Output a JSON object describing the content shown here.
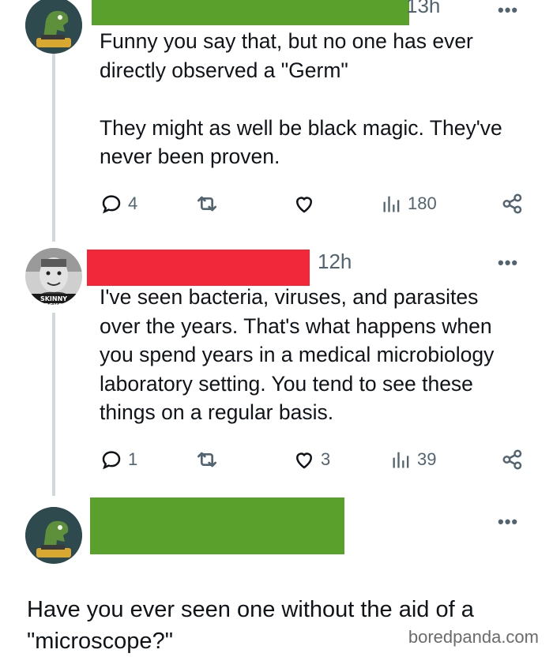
{
  "colors": {
    "redact_green": "#5aa02c",
    "redact_red": "#f0283a",
    "icon_gray": "#536471",
    "thread_line": "#cfd9de"
  },
  "tweets": [
    {
      "avatar": "dinosaur-avatar",
      "redaction_color": "green",
      "time": "13h",
      "text": "Funny you say that, but no one has ever\ndirectly observed a \"Germ\"\n\nThey might as well be black magic. They've\nnever been proven.",
      "actions": {
        "replies": "4",
        "retweets": "",
        "likes": "",
        "views": "180"
      }
    },
    {
      "avatar": "man-portrait-avatar",
      "avatar_caption": "SKINNY RECKON",
      "redaction_color": "red",
      "time": "12h",
      "text": "I've seen bacteria, viruses, and parasites\nover the years. That's what happens when\nyou spend years in a medical microbiology\nlaboratory setting. You tend to see these\nthings on a regular basis.",
      "actions": {
        "replies": "1",
        "retweets": "",
        "likes": "3",
        "views": "39"
      }
    },
    {
      "avatar": "dinosaur-avatar",
      "redaction_color": "green",
      "time": "",
      "text": "Have you ever seen one without the aid of a \"microscope?\""
    }
  ],
  "more_glyph": "•••",
  "watermark": "boredpanda.com"
}
